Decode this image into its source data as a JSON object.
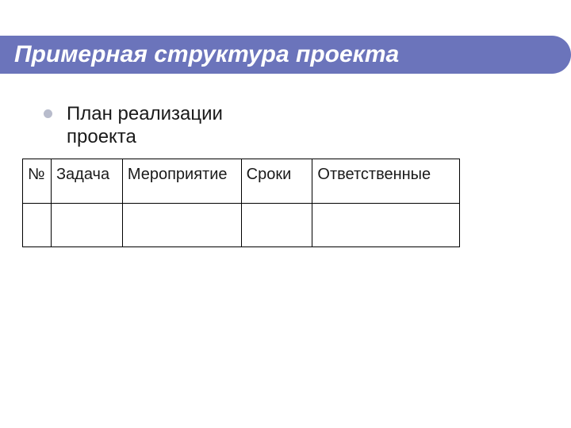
{
  "slide": {
    "title": "Примерная структура проекта",
    "bullet": "План  реализации проекта",
    "table": {
      "headers": {
        "num": "№",
        "task": "Задача",
        "event": "Мероприятие",
        "dates": "Сроки",
        "responsible": "Ответственные"
      },
      "row1": {
        "num": "",
        "task": "",
        "event": "",
        "dates": "",
        "responsible": ""
      }
    }
  }
}
